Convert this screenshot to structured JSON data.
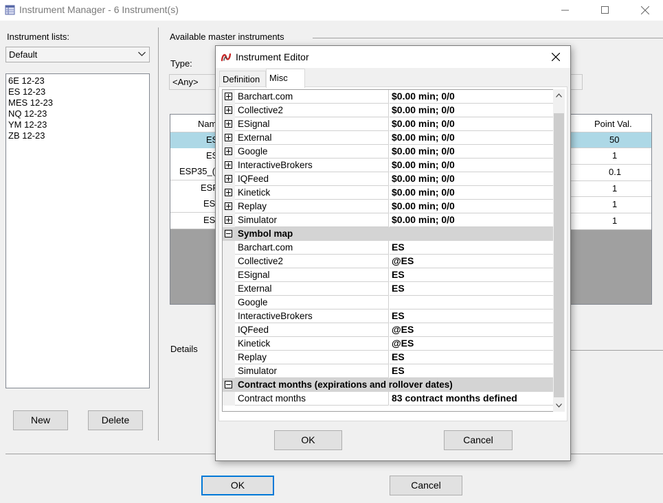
{
  "window": {
    "title": "Instrument Manager - 6 Instrument(s)",
    "icon": "instrument-manager-icon"
  },
  "left_panel": {
    "lists_label": "Instrument lists:",
    "list_selected": "Default",
    "instruments": [
      "6E 12-23",
      "ES 12-23",
      "MES 12-23",
      "NQ 12-23",
      "YM 12-23",
      "ZB 12-23"
    ],
    "new_label": "New",
    "delete_label": "Delete"
  },
  "master": {
    "group_label": "Available master instruments",
    "type_label": "Type:",
    "type_value": "<Any>",
    "columns": {
      "name": "Nam",
      "point_value": "Point Val."
    },
    "rows": [
      {
        "name": "ES",
        "point_value": "50"
      },
      {
        "name": "ES",
        "point_value": "1"
      },
      {
        "name": "ESP35_(",
        "point_value": "0.1"
      },
      {
        "name": "ESF",
        "point_value": "1"
      },
      {
        "name": "ES",
        "point_value": "1"
      },
      {
        "name": "ES",
        "point_value": "1"
      }
    ],
    "details_label": "Details"
  },
  "footer": {
    "ok_label": "OK",
    "cancel_label": "Cancel"
  },
  "dialog": {
    "title": "Instrument Editor",
    "tabs": [
      "Definition",
      "Misc"
    ],
    "active_tab": "Misc",
    "commission_rows": [
      {
        "name": "Barchart.com",
        "value": "$0.00 min;  0/0"
      },
      {
        "name": "Collective2",
        "value": "$0.00 min;  0/0"
      },
      {
        "name": "ESignal",
        "value": "$0.00 min;  0/0"
      },
      {
        "name": "External",
        "value": "$0.00 min;  0/0"
      },
      {
        "name": "Google",
        "value": "$0.00 min;  0/0"
      },
      {
        "name": "InteractiveBrokers",
        "value": "$0.00 min;  0/0"
      },
      {
        "name": "IQFeed",
        "value": "$0.00 min;  0/0"
      },
      {
        "name": "Kinetick",
        "value": "$0.00 min;  0/0"
      },
      {
        "name": "Replay",
        "value": "$0.00 min;  0/0"
      },
      {
        "name": "Simulator",
        "value": "$0.00 min;  0/0"
      }
    ],
    "symbol_map_label": "Symbol map",
    "symbol_map_rows": [
      {
        "name": "Barchart.com",
        "value": "ES"
      },
      {
        "name": "Collective2",
        "value": "@ES"
      },
      {
        "name": "ESignal",
        "value": "ES"
      },
      {
        "name": "External",
        "value": "ES"
      },
      {
        "name": "Google",
        "value": ""
      },
      {
        "name": "InteractiveBrokers",
        "value": "ES"
      },
      {
        "name": "IQFeed",
        "value": "@ES"
      },
      {
        "name": "Kinetick",
        "value": "@ES"
      },
      {
        "name": "Replay",
        "value": "ES"
      },
      {
        "name": "Simulator",
        "value": "ES"
      }
    ],
    "contract_months_label": "Contract months (expirations and rollover dates)",
    "contract_months_row": {
      "name": "Contract months",
      "value": "83 contract months defined"
    },
    "ok_label": "OK",
    "cancel_label": "Cancel"
  },
  "colors": {
    "selection": "#add8e6",
    "category_row": "#d4d4d4",
    "default_button_border": "#0078d7",
    "dialog_icon_red": "#c62828"
  }
}
